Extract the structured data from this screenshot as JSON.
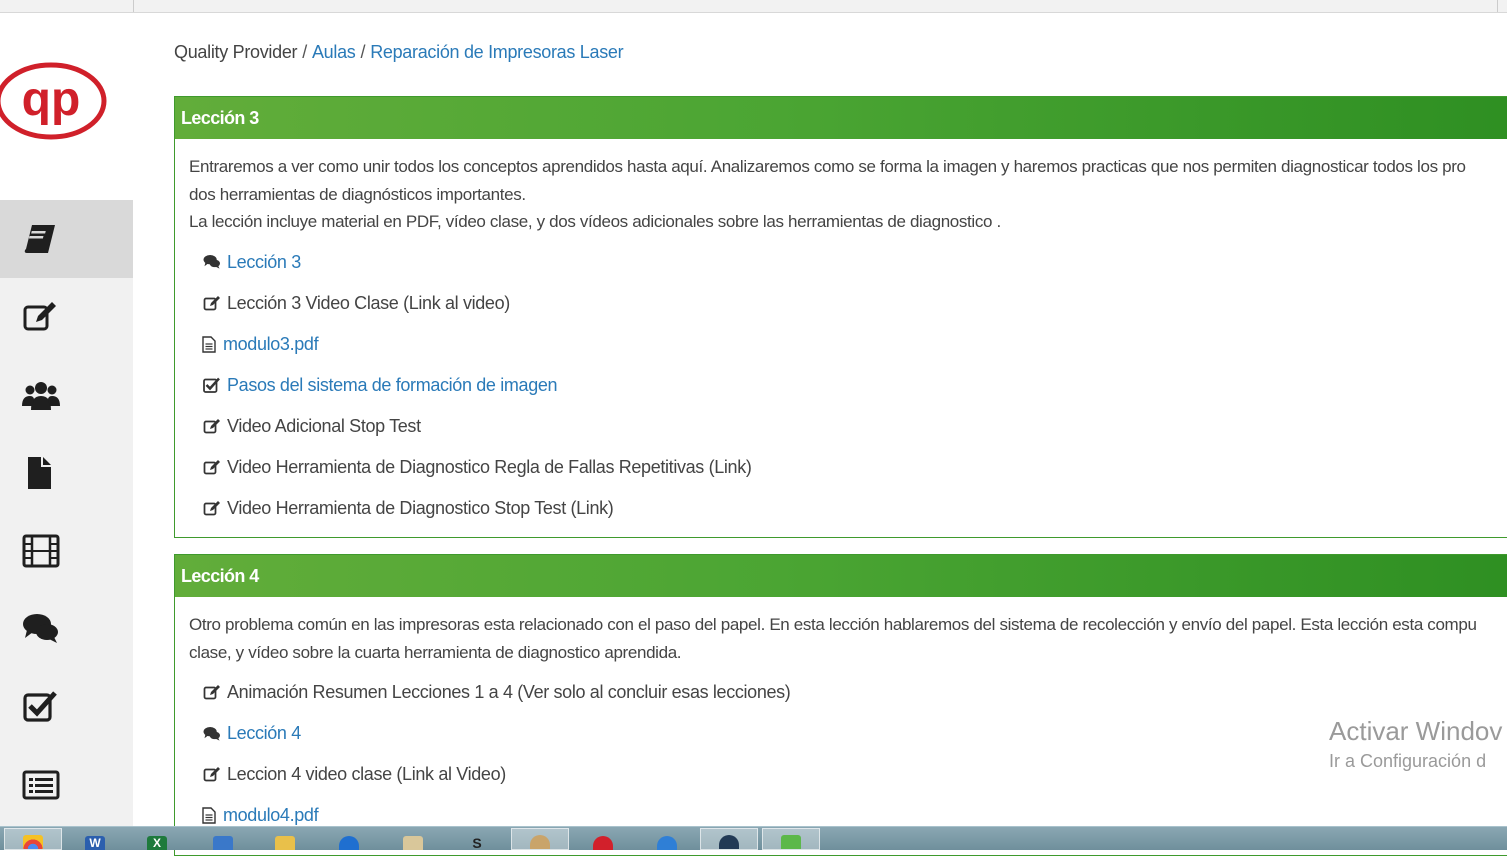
{
  "breadcrumb": {
    "root": "Quality Provider",
    "separator": "/",
    "aulas": "Aulas",
    "course": "Reparación de Impresoras Laser"
  },
  "sidebar": {
    "items": [
      {
        "icon": "book-icon",
        "active": true
      },
      {
        "icon": "edit-icon",
        "active": false
      },
      {
        "icon": "users-icon",
        "active": false
      },
      {
        "icon": "file-icon",
        "active": false
      },
      {
        "icon": "film-icon",
        "active": false
      },
      {
        "icon": "comments-icon",
        "active": false
      },
      {
        "icon": "check-square-icon",
        "active": false
      },
      {
        "icon": "list-icon",
        "active": false
      }
    ]
  },
  "lessons": [
    {
      "title": "Lección 3",
      "description": [
        "Entraremos a ver como unir todos los conceptos aprendidos hasta aquí. Analizaremos como se forma la imagen y haremos practicas que nos permiten diagnosticar todos los pro",
        "dos herramientas de diagnósticos importantes.",
        "La lección incluye material en PDF, vídeo clase, y dos vídeos adicionales sobre las herramientas de diagnostico ."
      ],
      "items": [
        {
          "icon": "comments-icon",
          "label": "Lección 3",
          "link": true
        },
        {
          "icon": "edit-icon",
          "label": "Lección 3 Video Clase (Link al video)",
          "link": false
        },
        {
          "icon": "file-text-icon",
          "label": "modulo3.pdf",
          "link": true
        },
        {
          "icon": "check-square-icon",
          "label": "Pasos del sistema de formación de imagen",
          "link": true
        },
        {
          "icon": "edit-icon",
          "label": "Video Adicional Stop Test",
          "link": false
        },
        {
          "icon": "edit-icon",
          "label": "Video Herramienta de Diagnostico Regla de Fallas Repetitivas (Link)",
          "link": false
        },
        {
          "icon": "edit-icon",
          "label": "Video Herramienta de Diagnostico Stop Test (Link)",
          "link": false
        }
      ]
    },
    {
      "title": "Lección 4",
      "description": [
        "Otro problema común en las impresoras esta relacionado con el paso del papel. En esta lección hablaremos del sistema de recolección y envío del papel. Esta lección esta compu",
        "clase, y vídeo sobre la cuarta herramienta de diagnostico aprendida."
      ],
      "items": [
        {
          "icon": "edit-icon",
          "label": "Animación Resumen Lecciones 1 a 4 (Ver solo al concluir esas lecciones)",
          "link": false
        },
        {
          "icon": "comments-icon",
          "label": "Lección 4",
          "link": true
        },
        {
          "icon": "edit-icon",
          "label": "Leccion 4 video clase (Link al Video)",
          "link": false
        },
        {
          "icon": "file-text-icon",
          "label": "modulo4.pdf",
          "link": true
        }
      ]
    }
  ],
  "watermark": {
    "line1": "Activar Windov",
    "line2": "Ir a Configuración d"
  },
  "colors": {
    "panel_green": "#4ba533",
    "link_blue": "#2a7ab8",
    "logo_red": "#d0202a"
  },
  "taskbar": {
    "apps": [
      {
        "icon": "chrome-icon",
        "label": ""
      },
      {
        "icon": "word-icon",
        "label": "W"
      },
      {
        "icon": "excel-icon",
        "label": "X"
      },
      {
        "icon": "network-icon",
        "label": ""
      },
      {
        "icon": "folder-icon",
        "label": ""
      },
      {
        "icon": "teamviewer-icon",
        "label": ""
      },
      {
        "icon": "paint-icon",
        "label": ""
      },
      {
        "icon": "skype-icon",
        "label": "S"
      },
      {
        "icon": "palette-icon",
        "label": ""
      },
      {
        "icon": "opera-icon",
        "label": ""
      },
      {
        "icon": "globe-icon",
        "label": ""
      },
      {
        "icon": "steam-icon",
        "label": ""
      },
      {
        "icon": "download-icon",
        "label": ""
      }
    ]
  }
}
